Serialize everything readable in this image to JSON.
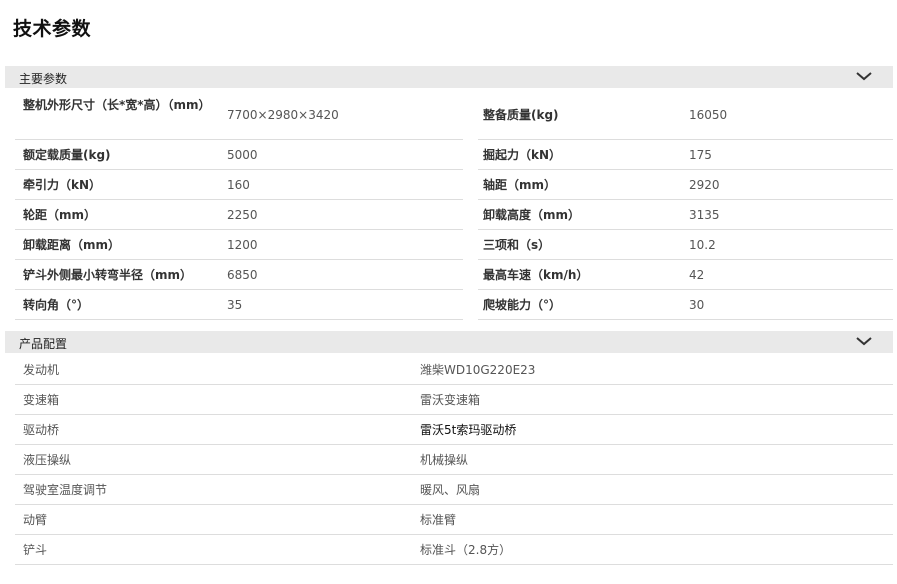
{
  "page": {
    "title": "技术参数"
  },
  "sections": {
    "main": {
      "title": "主要参数",
      "toggle_icon": "chevron-down-icon",
      "rows": [
        {
          "left": {
            "key": "整机外形尺寸（长*宽*高）（mm）",
            "value": "7700×2980×3420"
          },
          "right": {
            "key": "整备质量(kg)",
            "value": "16050"
          }
        },
        {
          "left": {
            "key": "额定载质量(kg)",
            "value": "5000"
          },
          "right": {
            "key": "掘起力（kN）",
            "value": "175"
          }
        },
        {
          "left": {
            "key": "牵引力（kN）",
            "value": "160"
          },
          "right": {
            "key": "轴距（mm）",
            "value": "2920"
          }
        },
        {
          "left": {
            "key": "轮距（mm）",
            "value": "2250"
          },
          "right": {
            "key": "卸载高度（mm）",
            "value": "3135"
          }
        },
        {
          "left": {
            "key": "卸载距离（mm）",
            "value": "1200"
          },
          "right": {
            "key": "三项和（s）",
            "value": "10.2"
          }
        },
        {
          "left": {
            "key": "铲斗外侧最小转弯半径（mm）",
            "value": "6850"
          },
          "right": {
            "key": "最高车速（km/h）",
            "value": "42"
          }
        },
        {
          "left": {
            "key": "转向角（°）",
            "value": "35"
          },
          "right": {
            "key": "爬坡能力（°）",
            "value": "30"
          }
        }
      ]
    },
    "config": {
      "title": "产品配置",
      "toggle_icon": "chevron-down-icon",
      "rows": [
        {
          "key": "发动机",
          "value": "潍柴WD10G220E23"
        },
        {
          "key": "变速箱",
          "value": "雷沃变速箱"
        },
        {
          "key": "驱动桥",
          "value": "雷沃5t索玛驱动桥"
        },
        {
          "key": "液压操纵",
          "value": "机械操纵"
        },
        {
          "key": "驾驶室温度调节",
          "value": "暖风、风扇"
        },
        {
          "key": "动臂",
          "value": "标准臂"
        },
        {
          "key": "铲斗",
          "value": "标准斗（2.8方）"
        }
      ]
    }
  }
}
